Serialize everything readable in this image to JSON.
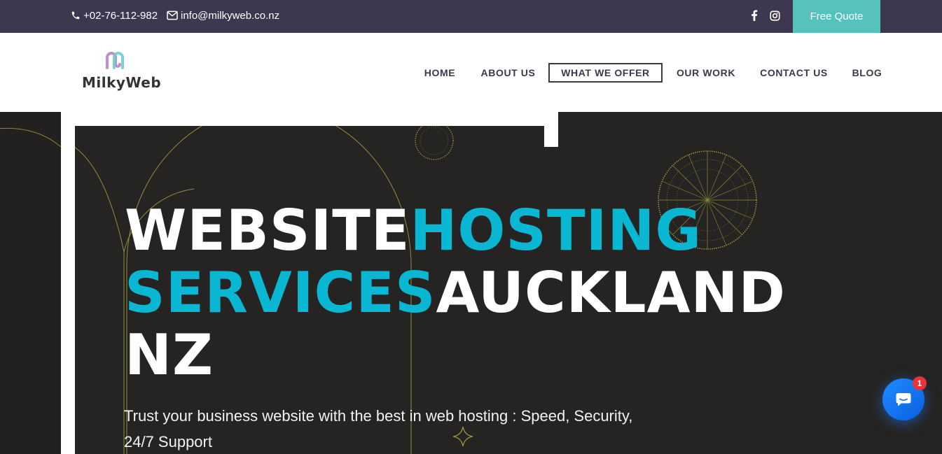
{
  "topbar": {
    "phone": "+02-76-112-982",
    "email": "info@milkyweb.co.nz",
    "quote_button": "Free Quote",
    "social_icons": [
      "facebook-icon",
      "instagram-icon"
    ],
    "bg_color": "#3d374f",
    "accent_color": "#55c3bc"
  },
  "header": {
    "logo_text": "MilkyWeb",
    "nav": [
      {
        "label": "HOME",
        "active": false
      },
      {
        "label": "ABOUT US",
        "active": false
      },
      {
        "label": "WHAT WE OFFER",
        "active": true
      },
      {
        "label": "OUR WORK",
        "active": false
      },
      {
        "label": "CONTACT US",
        "active": false
      },
      {
        "label": "BLOG",
        "active": false
      }
    ]
  },
  "hero": {
    "title_part1": "WEBSITE",
    "title_part2": "HOSTING SERVICES",
    "title_part3": "AUCKLAND NZ",
    "subtitle": "Trust your business website with the best in web hosting : Speed, Security, 24/7 Support",
    "highlight_color": "#0ab7d3",
    "bg_color": "#262422"
  },
  "chat": {
    "badge_count": "1",
    "icon": "chat-icon"
  }
}
